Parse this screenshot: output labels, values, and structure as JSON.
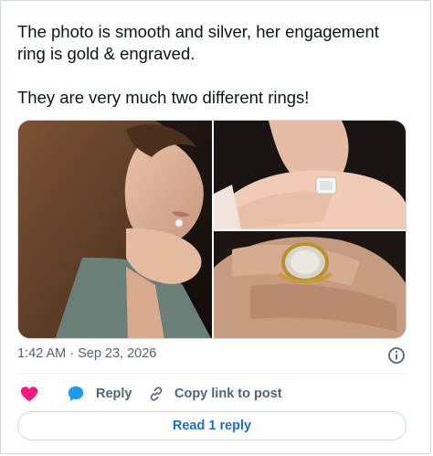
{
  "tweet": {
    "text": "The photo is smooth and silver, her engagement ring is gold & engraved.\n\nThey are very much two different rings!",
    "timestamp": "1:42 AM · Sep 23, 2026"
  },
  "media": {
    "images": [
      "photo-woman-chin-on-hand",
      "photo-hand-silver-ring",
      "photo-hand-gold-ring"
    ]
  },
  "actions": {
    "like_icon": "heart-icon",
    "reply_label": "Reply",
    "copy_label": "Copy link to post"
  },
  "read_replies": {
    "label": "Read 1 reply"
  },
  "colors": {
    "like": "#f91880",
    "reply_icon": "#1d9bf0",
    "link": "#1d6fbf",
    "secondary_text": "#536471"
  }
}
